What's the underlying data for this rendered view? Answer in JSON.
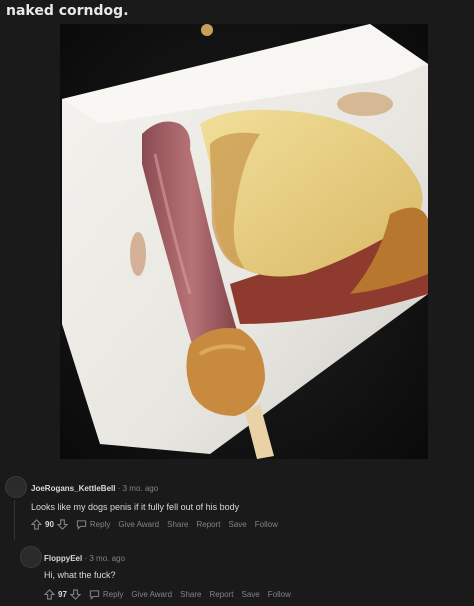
{
  "post": {
    "title": "naked corndog."
  },
  "comments": [
    {
      "username": "JoeRogans_KettleBell",
      "age": "3 mo. ago",
      "body": "Looks like my dogs penis if it fully fell out of his body",
      "score": "90",
      "actions": {
        "reply": "Reply",
        "award": "Give Award",
        "share": "Share",
        "report": "Report",
        "save": "Save",
        "follow": "Follow"
      }
    },
    {
      "username": "FloppyEel",
      "age": "3 mo. ago",
      "body": "Hi, what the fuck?",
      "score": "97",
      "actions": {
        "reply": "Reply",
        "award": "Give Award",
        "share": "Share",
        "report": "Report",
        "save": "Save",
        "follow": "Follow"
      }
    }
  ],
  "separator": "·",
  "icons": {
    "upvote": "arrow-up-icon",
    "downvote": "arrow-down-icon",
    "reply": "speech-bubble-icon"
  },
  "colors": {
    "background": "#1a1a1b",
    "text": "#d7dadc",
    "muted": "#818384"
  }
}
